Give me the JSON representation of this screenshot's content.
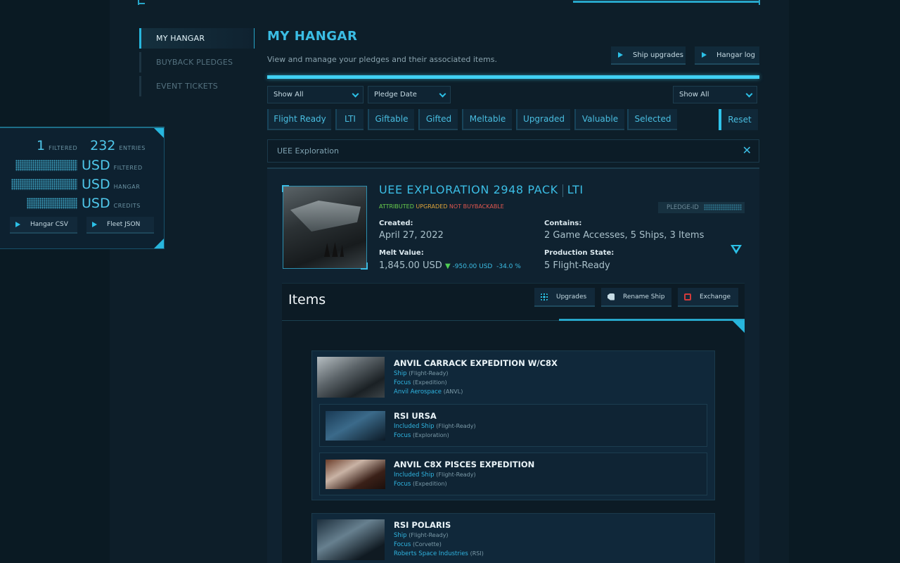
{
  "sidebar": {
    "items": [
      {
        "label": "MY HANGAR"
      },
      {
        "label": "BUYBACK PLEDGES"
      },
      {
        "label": "EVENT TICKETS"
      }
    ]
  },
  "summary": {
    "filtered_count": "1",
    "filtered_label": "FILTERED",
    "entries_count": "232",
    "entries_label": "ENTRIES",
    "rows": [
      {
        "currency": "USD",
        "label": "FILTERED"
      },
      {
        "currency": "USD",
        "label": "HANGAR"
      },
      {
        "currency": "USD",
        "label": "CREDITS"
      }
    ],
    "buttons": [
      "Hangar CSV",
      "Fleet JSON"
    ]
  },
  "header": {
    "title": "MY HANGAR",
    "subtitle": "View and manage your pledges and their associated items.",
    "buttons": [
      "Ship upgrades",
      "Hangar log"
    ]
  },
  "filters": {
    "select_left": "Show All",
    "select_sort": "Pledge Date",
    "select_right": "Show All",
    "tags": [
      "Flight Ready",
      "LTI",
      "Giftable",
      "Gifted",
      "Meltable",
      "Upgraded",
      "Valuable",
      "Selected"
    ],
    "reset": "Reset"
  },
  "search": {
    "value": "UEE Exploration",
    "clear_glyph": "✕"
  },
  "pledge": {
    "title": "UEE EXPLORATION 2948 PACK",
    "insurance": "LTI",
    "flag_attributed": "ATTRIBUTED",
    "flag_upgraded": "UPGRADED",
    "flag_not_buybackable": "NOT BUYBACKABLE",
    "pledge_id_label": "PLEDGE-ID",
    "created_label": "Created:",
    "created_value": "April 27, 2022",
    "contains_label": "Contains:",
    "contains_value": "2 Game Accesses, 5 Ships, 3 Items",
    "melt_label": "Melt Value:",
    "melt_value": "1,845.00 USD",
    "melt_delta_arrow": "▼",
    "melt_delta": "-950.00 USD",
    "melt_pct": "-34.0 %",
    "production_label": "Production State:",
    "production_value": "5 Flight-Ready"
  },
  "items": {
    "title": "Items",
    "buttons": [
      "Upgrades",
      "Rename Ship",
      "Exchange"
    ],
    "cards": [
      {
        "name": "ANVIL CARRACK EXPEDITION W/C8X",
        "type": "Ship",
        "type_detail": "(Flight-Ready)",
        "focus": "Focus",
        "focus_detail": "(Expedition)",
        "maker": "Anvil Aerospace",
        "maker_detail": "(ANVL)",
        "subs": [
          {
            "name": "RSI URSA",
            "type": "Included Ship",
            "type_detail": "(Flight-Ready)",
            "focus": "Focus",
            "focus_detail": "(Exploration)"
          },
          {
            "name": "ANVIL C8X PISCES EXPEDITION",
            "type": "Included Ship",
            "type_detail": "(Flight-Ready)",
            "focus": "Focus",
            "focus_detail": "(Expedition)"
          }
        ]
      },
      {
        "name": "RSI POLARIS",
        "type": "Ship",
        "type_detail": "(Flight-Ready)",
        "focus": "Focus",
        "focus_detail": "(Corvette)",
        "maker": "Roberts Space Industries",
        "maker_detail": "(RSI)"
      }
    ]
  },
  "colors": {
    "accent": "#3bbde4",
    "background": "#0d1e29",
    "attributed": "#6ad04d",
    "upgraded": "#e0a53a",
    "not_buybackable": "#e0574f"
  }
}
